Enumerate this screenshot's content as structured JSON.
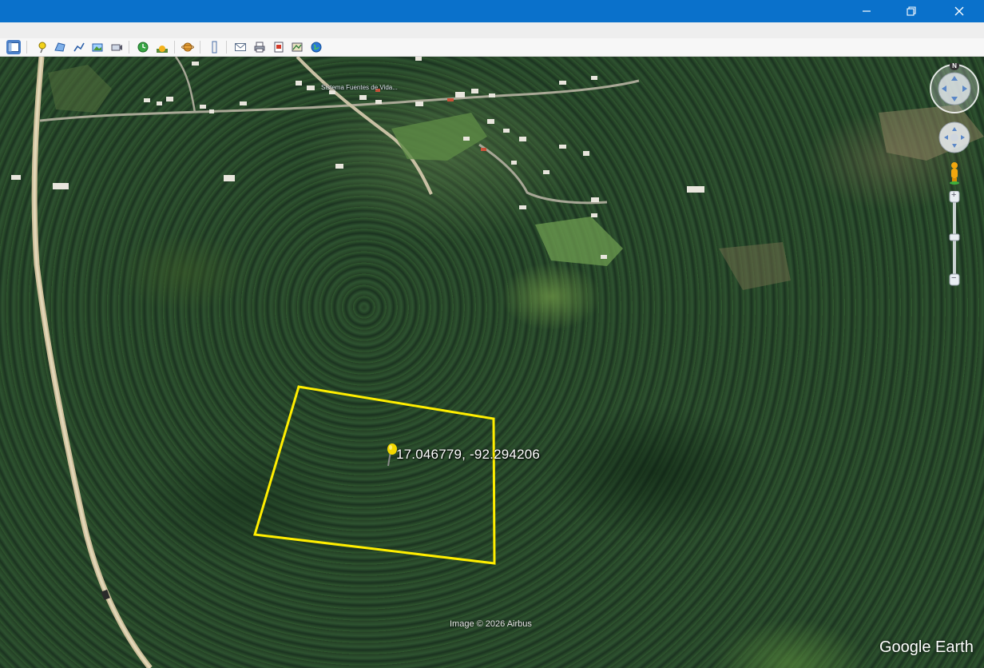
{
  "window": {
    "controls": [
      "minimize",
      "restore",
      "close"
    ]
  },
  "toolbar": {
    "buttons": [
      {
        "name": "sidebar-toggle-icon"
      },
      {
        "name": "add-placemark-icon"
      },
      {
        "name": "add-polygon-icon"
      },
      {
        "name": "add-path-icon"
      },
      {
        "name": "add-image-overlay-icon"
      },
      {
        "name": "record-tour-icon"
      },
      {
        "name": "historical-imagery-icon"
      },
      {
        "name": "sunlight-icon"
      },
      {
        "name": "switch-to-sky-icon"
      },
      {
        "name": "ruler-icon"
      },
      {
        "name": "email-icon"
      },
      {
        "name": "print-icon"
      },
      {
        "name": "save-image-icon"
      },
      {
        "name": "view-in-maps-icon"
      },
      {
        "name": "earth-gallery-icon"
      }
    ]
  },
  "map": {
    "placemark_label": "17.046779, -92.294206",
    "distant_label": "Sistema Fuentes de Vida...",
    "imagery_credit": "Image © 2026 Airbus",
    "brand": "Google Earth",
    "compass_letter": "N",
    "polygon_color": "#ffee00",
    "pin_color": "#f3d800"
  },
  "navigation": {
    "zoom_in": "+",
    "zoom_out": "−"
  }
}
